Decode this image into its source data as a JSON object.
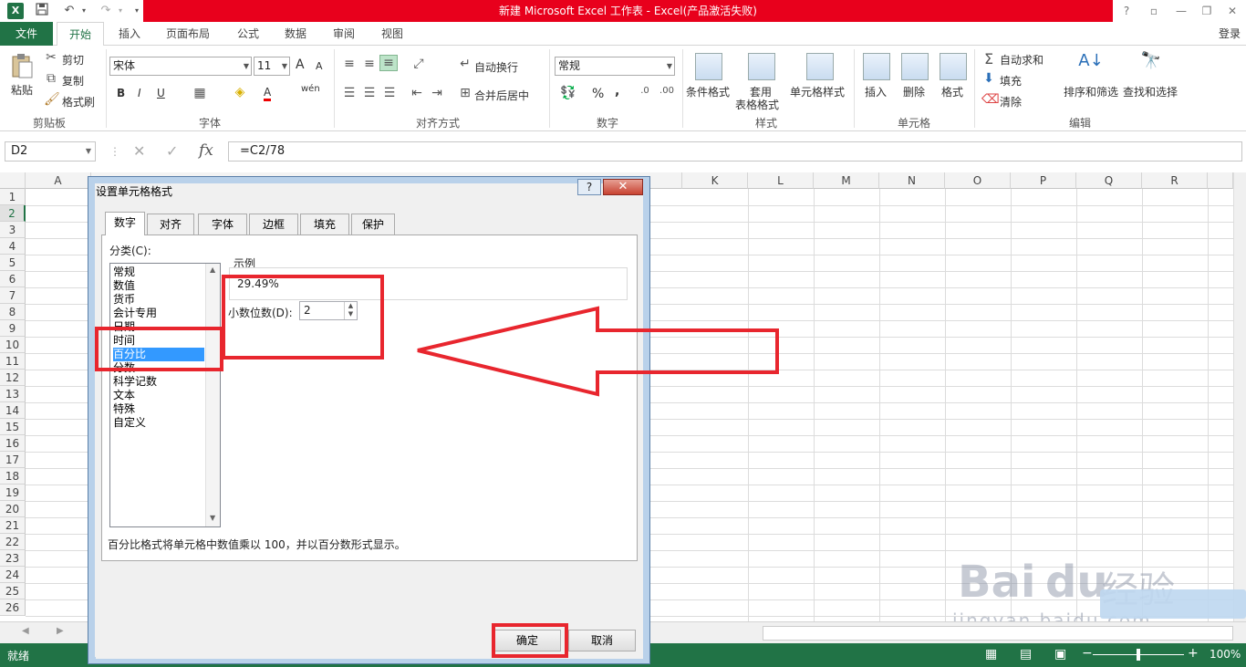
{
  "window": {
    "title": "新建 Microsoft Excel 工作表 -  Excel(产品激活失败)",
    "login": "登录",
    "help": "?",
    "restore": "▫",
    "minimize": "—",
    "maximize": "❐",
    "close": "✕"
  },
  "qat": {
    "logo": "X",
    "save_icon": "save-icon",
    "undo_icon": "undo-icon",
    "redo_icon": "redo-icon"
  },
  "tabs": [
    "文件",
    "开始",
    "插入",
    "页面布局",
    "公式",
    "数据",
    "审阅",
    "视图"
  ],
  "ribbon": {
    "clipboard": {
      "paste": "粘贴",
      "cut": "剪切",
      "copy": "复制",
      "format_painter": "格式刷",
      "label": "剪贴板"
    },
    "font": {
      "name": "宋体",
      "size": "11",
      "grow": "A",
      "shrink": "A",
      "bold": "B",
      "italic": "I",
      "underline": "U",
      "wen": "wén",
      "label": "字体"
    },
    "alignment": {
      "wrap": "自动换行",
      "merge": "合并后居中",
      "label": "对齐方式"
    },
    "number": {
      "format": "常规",
      "percent": "%",
      "comma": ",",
      "label": "数字"
    },
    "styles": {
      "conditional": "条件格式",
      "table_1": "套用",
      "table_2": "表格格式",
      "cell_styles": "单元格样式",
      "label": "样式"
    },
    "cells": {
      "insert": "插入",
      "delete": "删除",
      "format": "格式",
      "label": "单元格"
    },
    "editing": {
      "autosum": "自动求和",
      "fill": "填充",
      "clear": "清除",
      "sort": "排序和筛选",
      "find": "查找和选择",
      "label": "编辑"
    }
  },
  "formula_bar": {
    "name_box": "D2",
    "fx": "fx",
    "formula": "=C2/78"
  },
  "grid": {
    "columns": [
      "A",
      "K",
      "L",
      "M",
      "N",
      "O",
      "P",
      "Q",
      "R"
    ],
    "rows": [
      "1",
      "2",
      "3",
      "4",
      "5",
      "6",
      "7",
      "8",
      "9",
      "10",
      "11",
      "12",
      "13",
      "14",
      "15",
      "16",
      "17",
      "18",
      "19",
      "20",
      "21",
      "22",
      "23",
      "24",
      "25",
      "26"
    ]
  },
  "status": {
    "ready": "就绪",
    "zoom": "100%",
    "minus": "−",
    "plus": "+"
  },
  "dialog": {
    "title": "设置单元格格式",
    "help": "?",
    "close": "✕",
    "tabs": [
      "数字",
      "对齐",
      "字体",
      "边框",
      "填充",
      "保护"
    ],
    "category_label": "分类(C):",
    "categories": [
      "常规",
      "数值",
      "货币",
      "会计专用",
      "日期",
      "时间",
      "百分比",
      "分数",
      "科学记数",
      "文本",
      "特殊",
      "自定义"
    ],
    "selected_category": "百分比",
    "sample_label": "示例",
    "sample_value": "29.49%",
    "decimal_label": "小数位数(D):",
    "decimal_value": "2",
    "description": "百分比格式将单元格中数值乘以 100，并以百分数形式显示。",
    "ok": "确定",
    "cancel": "取消"
  },
  "watermark": {
    "text1": "Bai",
    "text2": "du",
    "text3": "经验",
    "url": "jingyan.baidu.com"
  },
  "colors": {
    "excel_green": "#217346",
    "title_red": "#e8001c",
    "annotation_red": "#e8262e",
    "selection_blue": "#3399ff"
  }
}
